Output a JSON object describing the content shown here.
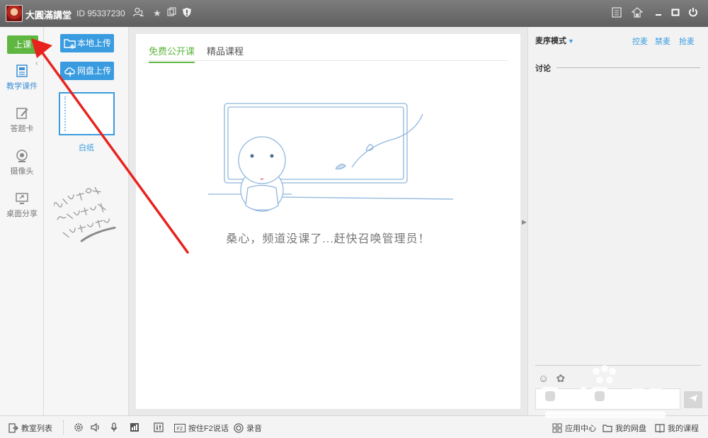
{
  "titlebar": {
    "room_name": "大圓滿講堂",
    "room_id": "ID 95337230",
    "online_count": "1",
    "icons": [
      "user-icon",
      "star-icon",
      "copy-icon",
      "shield-icon",
      "notes-icon",
      "gift-icon",
      "minimize-icon",
      "maximize-icon",
      "power-icon"
    ]
  },
  "leftbar": {
    "class_button": "上课",
    "items": [
      {
        "label": "教学课件",
        "icon": "courseware-icon",
        "active": true
      },
      {
        "label": "答题卡",
        "icon": "answer-card-icon",
        "active": false
      },
      {
        "label": "摄像头",
        "icon": "camera-icon",
        "active": false
      },
      {
        "label": "桌面分享",
        "icon": "screen-share-icon",
        "active": false
      }
    ]
  },
  "coursebar": {
    "local_upload": "本地上传",
    "cloud_upload": "网盘上传",
    "whiteboard_label": "白纸"
  },
  "main": {
    "tabs": [
      {
        "label": "免费公开课",
        "active": true
      },
      {
        "label": "精品课程",
        "active": false
      }
    ],
    "empty_message": "桑心，频道没课了...赶快召唤管理员！"
  },
  "rightpanel": {
    "mic_mode": "麦序模式",
    "links": [
      "控麦",
      "禁麦",
      "抢麦"
    ],
    "discuss_title": "讨论"
  },
  "bottombar": {
    "class_list": "教室列表",
    "push_to_talk": "按住F2说话",
    "record": "录音",
    "app_center": "应用中心",
    "my_disk": "我的网盘",
    "my_courses": "我的课程"
  },
  "colors": {
    "accent_green": "#5fb640",
    "accent_blue": "#3a9ce0",
    "annotation_red": "#e8231e"
  }
}
